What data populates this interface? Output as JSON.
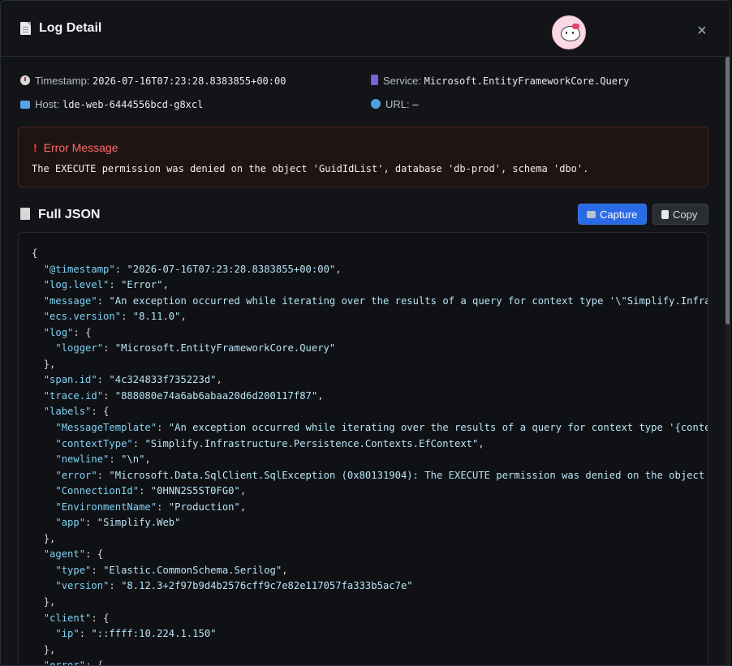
{
  "header": {
    "title": "Log Detail",
    "close_label": "×"
  },
  "meta": {
    "timestamp_label": "Timestamp:",
    "timestamp_value": "2026-07-16T07:23:28.8383855+00:00",
    "service_label": "Service:",
    "service_value": "Microsoft.EntityFrameworkCore.Query",
    "host_label": "Host:",
    "host_value": "lde-web-6444556bcd-g8xcl",
    "url_label": "URL:",
    "url_value": "–"
  },
  "error": {
    "title": "Error Message",
    "message": "The EXECUTE permission was denied on the object 'GuidIdList', database 'db-prod', schema 'dbo'."
  },
  "json_section": {
    "title": "Full JSON",
    "capture_label": "Capture",
    "copy_label": "Copy"
  },
  "json_lines": [
    {
      "i": 0,
      "k": "",
      "v": "",
      "t": "{"
    },
    {
      "i": 1,
      "k": "\"@timestamp\"",
      "v": "\"2026-07-16T07:23:28.8383855+00:00\"",
      "t": ","
    },
    {
      "i": 1,
      "k": "\"log.level\"",
      "v": "\"Error\"",
      "t": ","
    },
    {
      "i": 1,
      "k": "\"message\"",
      "v": "\"An exception occurred while iterating over the results of a query for context type '\\\"Simplify.Infrastr",
      "t": ""
    },
    {
      "i": 1,
      "k": "\"ecs.version\"",
      "v": "\"8.11.0\"",
      "t": ","
    },
    {
      "i": 1,
      "k": "\"log\"",
      "v": "",
      "t": "{"
    },
    {
      "i": 2,
      "k": "\"logger\"",
      "v": "\"Microsoft.EntityFrameworkCore.Query\"",
      "t": ""
    },
    {
      "i": 1,
      "k": "",
      "v": "",
      "t": "},"
    },
    {
      "i": 1,
      "k": "\"span.id\"",
      "v": "\"4c324833f735223d\"",
      "t": ","
    },
    {
      "i": 1,
      "k": "\"trace.id\"",
      "v": "\"888080e74a6ab6abaa20d6d200117f87\"",
      "t": ","
    },
    {
      "i": 1,
      "k": "\"labels\"",
      "v": "",
      "t": "{"
    },
    {
      "i": 2,
      "k": "\"MessageTemplate\"",
      "v": "\"An exception occurred while iterating over the results of a query for context type '{contextT",
      "t": ""
    },
    {
      "i": 2,
      "k": "\"contextType\"",
      "v": "\"Simplify.Infrastructure.Persistence.Contexts.EfContext\"",
      "t": ","
    },
    {
      "i": 2,
      "k": "\"newline\"",
      "v": "\"\\n\"",
      "t": ","
    },
    {
      "i": 2,
      "k": "\"error\"",
      "v": "\"Microsoft.Data.SqlClient.SqlException (0x80131904): The EXECUTE permission was denied on the object 'Gu",
      "t": ""
    },
    {
      "i": 2,
      "k": "\"ConnectionId\"",
      "v": "\"0HNN2S5ST0FG0\"",
      "t": ","
    },
    {
      "i": 2,
      "k": "\"EnvironmentName\"",
      "v": "\"Production\"",
      "t": ","
    },
    {
      "i": 2,
      "k": "\"app\"",
      "v": "\"Simplify.Web\"",
      "t": ""
    },
    {
      "i": 1,
      "k": "",
      "v": "",
      "t": "},"
    },
    {
      "i": 1,
      "k": "\"agent\"",
      "v": "",
      "t": "{"
    },
    {
      "i": 2,
      "k": "\"type\"",
      "v": "\"Elastic.CommonSchema.Serilog\"",
      "t": ","
    },
    {
      "i": 2,
      "k": "\"version\"",
      "v": "\"8.12.3+2f97b9d4b2576cff9c7e82e117057fa333b5ac7e\"",
      "t": ""
    },
    {
      "i": 1,
      "k": "",
      "v": "",
      "t": "},"
    },
    {
      "i": 1,
      "k": "\"client\"",
      "v": "",
      "t": "{"
    },
    {
      "i": 2,
      "k": "\"ip\"",
      "v": "\"::ffff:10.224.1.150\"",
      "t": ""
    },
    {
      "i": 1,
      "k": "",
      "v": "",
      "t": "},"
    },
    {
      "i": 1,
      "k": "\"error\"",
      "v": "",
      "t": "{"
    }
  ]
}
